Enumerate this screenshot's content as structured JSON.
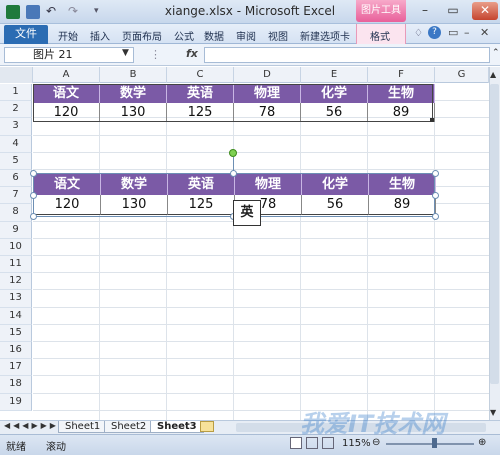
{
  "window": {
    "title": "xiange.xlsx - Microsoft Excel",
    "context_tab": "图片工具",
    "min": "–",
    "max": "▭",
    "close": "✕"
  },
  "ribbon": {
    "tabs": [
      "文件",
      "开始",
      "插入",
      "页面布局",
      "公式",
      "数据",
      "审阅",
      "视图",
      "新建选项卡",
      "格式"
    ]
  },
  "formula_bar": {
    "name_box": "图片 21",
    "fx": "fx",
    "formula": ""
  },
  "columns": [
    "A",
    "B",
    "C",
    "D",
    "E",
    "F",
    "G"
  ],
  "rows": [
    "1",
    "2",
    "3",
    "4",
    "5",
    "6",
    "7",
    "8",
    "9",
    "10",
    "11",
    "12",
    "13",
    "14",
    "15",
    "16",
    "17",
    "18",
    "19"
  ],
  "table": {
    "headers": [
      "语文",
      "数学",
      "英语",
      "物理",
      "化学",
      "生物"
    ],
    "values": [
      "120",
      "130",
      "125",
      "78",
      "56",
      "89"
    ]
  },
  "picture": {
    "headers": [
      "语文",
      "数学",
      "英语",
      "物理",
      "化学",
      "生物"
    ],
    "values": [
      "120",
      "130",
      "125",
      "78",
      "56",
      "89"
    ],
    "tooltip": "英"
  },
  "sheets": [
    "Sheet1",
    "Sheet2",
    "Sheet3"
  ],
  "status": {
    "mode": "就绪",
    "scroll": "滚动",
    "zoom": "115%"
  },
  "watermark": "我爱IT技术网",
  "colors": {
    "header_fill": "#7b5aa6",
    "accent_blue": "#2b6cb3",
    "context_pink": "#e8609a"
  }
}
